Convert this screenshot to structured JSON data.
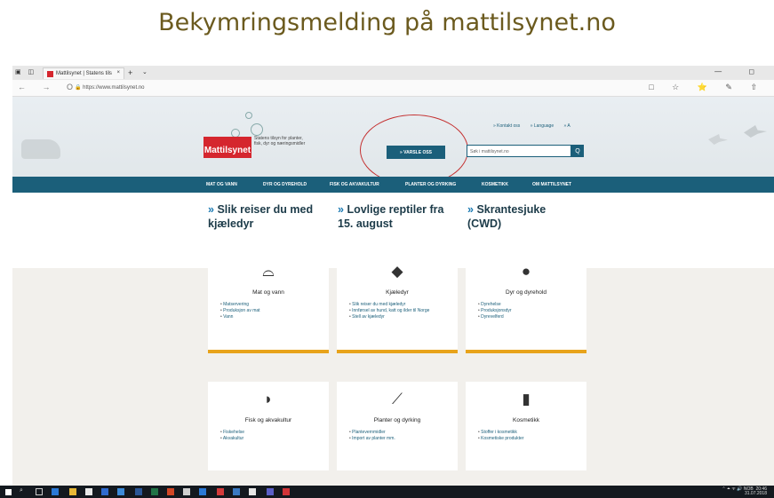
{
  "slide_title": "Bekymringsmelding på mattilsynet.no",
  "browser": {
    "tab_title": "Mattilsynet | Statens tils",
    "tab_close": "×",
    "new_tab": "+",
    "tab_menu": "⌄",
    "url": "https://www.mattilsynet.no",
    "nav": "← → O",
    "lock": "🔒",
    "window_controls": "— ◻",
    "toolbar": "□ ☆ ⭐ ✎ ⇧"
  },
  "site": {
    "logo": "Mattilsynet",
    "tagline": "Statens tilsyn for planter, fisk, dyr og næringsmidler",
    "top_links": [
      "» Kontakt oss",
      "» Language",
      "» A"
    ],
    "varsle_button": "»  VARSLE OSS",
    "search_placeholder": "Søk i mattilsynet.no",
    "search_button": "Q",
    "nav_items": [
      "MAT OG VANN",
      "DYR OG DYREHOLD",
      "FISK OG AKVAKULTUR",
      "PLANTER OG DYRKING",
      "KOSMETIKK",
      "OM MATTILSYNET"
    ],
    "headlines": [
      {
        "arrow": "»",
        "text": "Slik reiser du med kjæledyr"
      },
      {
        "arrow": "»",
        "text": "Lovlige reptiler fra 15. august"
      },
      {
        "arrow": "»",
        "text": "Skrantesjuke (CWD)"
      }
    ],
    "cards": [
      {
        "icon": "⌓",
        "title": "Mat og vann",
        "links": [
          "Matservering",
          "Produksjon av mat",
          "Vann"
        ]
      },
      {
        "icon": "◆",
        "title": "Kjæledyr",
        "links": [
          "Slik reiser du med kjæledyr",
          "Innførsel av hund, katt og ilder til Norge",
          "Stell av kjæledyr"
        ]
      },
      {
        "icon": "●",
        "title": "Dyr og dyrehold",
        "links": [
          "Dyrehelse",
          "Produksjonsdyr",
          "Dyrevelferd"
        ]
      },
      {
        "icon": "◗",
        "title": "Fisk og akvakultur",
        "links": [
          "Fiskehelse",
          "Akvakultur"
        ]
      },
      {
        "icon": "⟋",
        "title": "Planter og dyrking",
        "links": [
          "Plantevernmidler",
          "Import av planter mm."
        ]
      },
      {
        "icon": "▮",
        "title": "Kosmetikk",
        "links": [
          "Stoffer i kosmetikk",
          "Kosmetiske produkter"
        ]
      }
    ]
  },
  "taskbar": {
    "search_icon": "⌕",
    "tray_time": "20:46",
    "tray_date": "31.07.2018",
    "tray_icons": "⌃ ⏶ ᯤ 🔊 NOB"
  }
}
